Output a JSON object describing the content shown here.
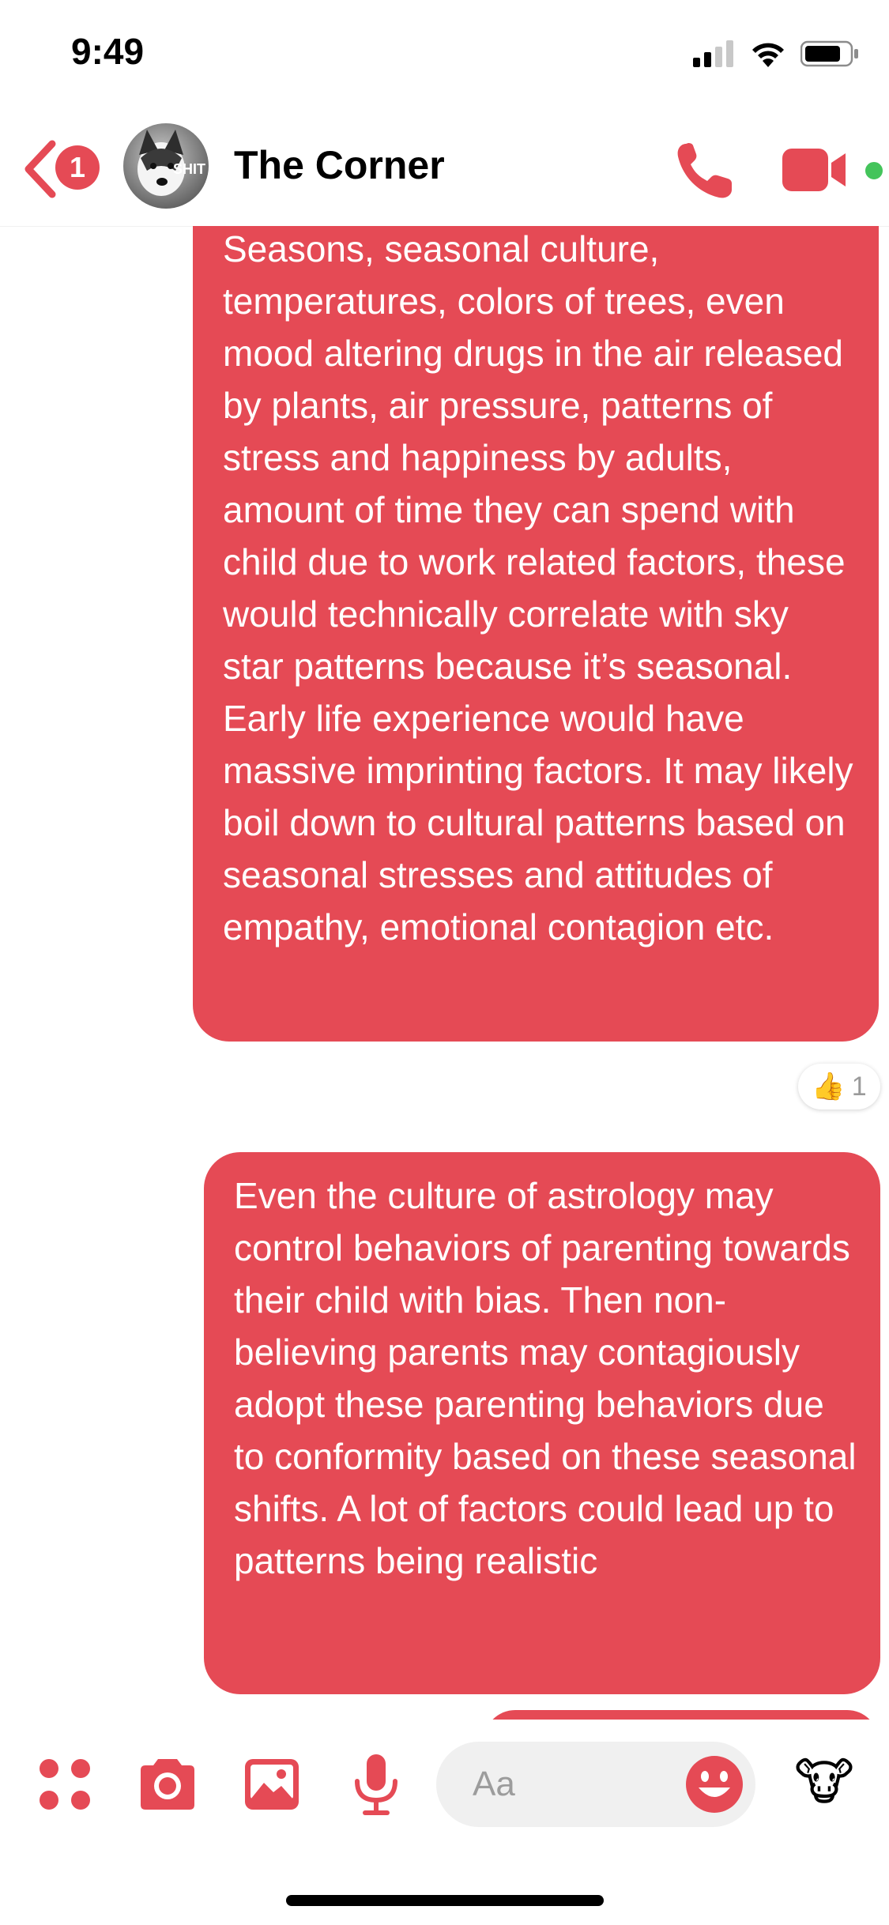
{
  "status_bar": {
    "time": "9:49",
    "icons": [
      "signal-icon",
      "wifi-icon",
      "battery-icon"
    ]
  },
  "header": {
    "unread_count": "1",
    "avatar_text": "SHIT",
    "title": "The Corner",
    "icons": [
      "back-chevron-icon",
      "phone-icon",
      "video-camera-icon"
    ],
    "accent_color": "#E54A55",
    "online_color": "#44C45B"
  },
  "messages": [
    {
      "text": "Seasons, seasonal culture, temperatures, colors of trees, even mood altering drugs in the air released by plants, air pressure, patterns of stress and happiness by adults, amount of time they can spend with child due to work related factors, these would technically correlate with sky star patterns because it’s seasonal. Early life experience would have massive imprinting factors. It may likely boil down to cultural patterns based on seasonal stresses and attitudes of empathy, emotional contagion etc.",
      "reaction": {
        "emoji": "👍",
        "count": "1"
      }
    },
    {
      "text": "Even the culture of astrology may control behaviors of parenting towards their child with bias. Then non-believing parents may contagiously adopt these parenting behaviors due to conformity based on these seasonal shifts. A lot of factors could lead up to patterns being realistic"
    }
  ],
  "composer": {
    "placeholder": "Aa",
    "tools": [
      "apps-icon",
      "camera-icon",
      "photo-icon",
      "microphone-icon"
    ],
    "emoji_icon": "smiley-icon",
    "quick_reaction": "🐮"
  }
}
